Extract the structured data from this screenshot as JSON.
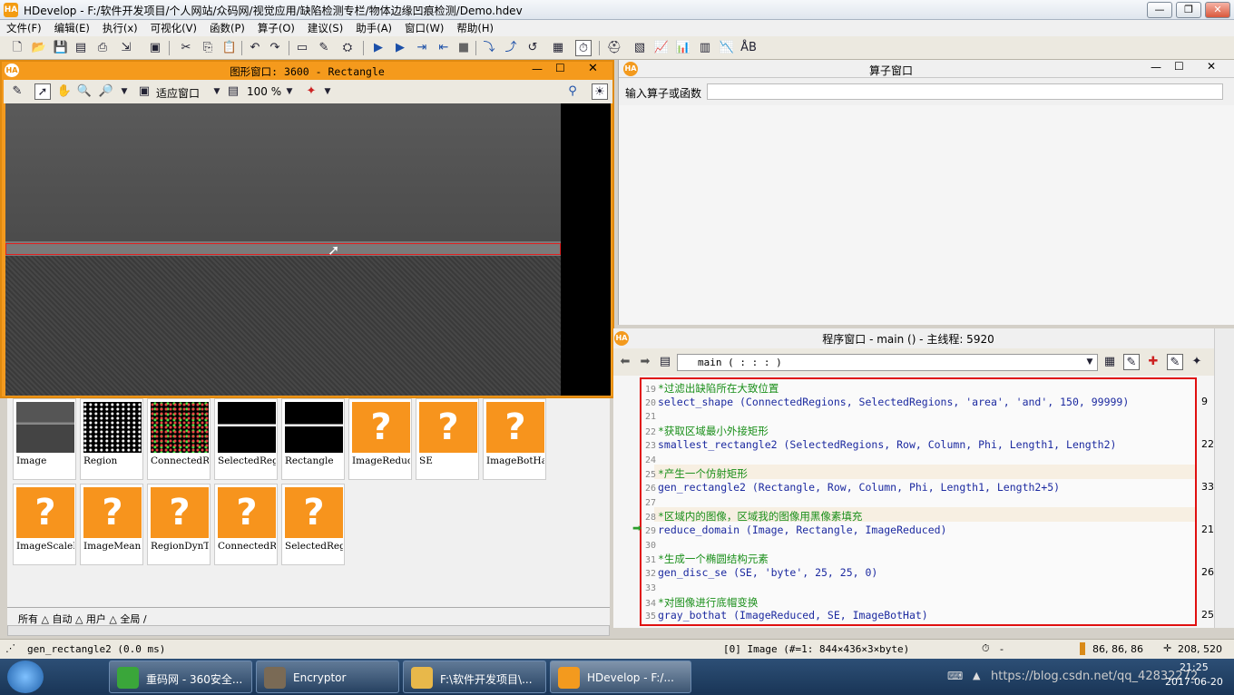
{
  "app": {
    "title": "HDevelop - F:/软件开发项目/个人网站/众码网/视觉应用/缺陷检测专栏/物体边缘凹痕检测/Demo.hdev",
    "logo": "HA"
  },
  "menu": [
    "文件(F)",
    "编辑(E)",
    "执行(x)",
    "可视化(V)",
    "函数(P)",
    "算子(O)",
    "建议(S)",
    "助手(A)",
    "窗口(W)",
    "帮助(H)"
  ],
  "graphics": {
    "title": "图形窗口: 3600 - Rectangle",
    "fit": "适应窗口",
    "zoom": "100 %"
  },
  "operator": {
    "title": "算子窗口",
    "input_label": "输入算子或函数"
  },
  "program": {
    "title": "程序窗口 - main () - 主线程: 5920",
    "proc": "main ( : : : )",
    "lines": [
      {
        "n": "19",
        "t": "*过滤出缺陷所在大致位置",
        "c": "cmt"
      },
      {
        "n": "20",
        "t": "select_shape (ConnectedRegions, SelectedRegions, 'area', 'and', 150, 99999)",
        "c": "cod"
      },
      {
        "n": "21",
        "t": "",
        "c": "cod"
      },
      {
        "n": "22",
        "t": "*获取区域最小外接矩形",
        "c": "cmt"
      },
      {
        "n": "23",
        "t": "smallest_rectangle2 (SelectedRegions, Row, Column, Phi, Length1, Length2)",
        "c": "cod"
      },
      {
        "n": "24",
        "t": "",
        "c": "cod"
      },
      {
        "n": "25",
        "t": "*产生一个仿射矩形",
        "c": "cmt"
      },
      {
        "n": "26",
        "t": "gen_rectangle2 (Rectangle, Row, Column, Phi, Length1, Length2+5)",
        "c": "cod"
      },
      {
        "n": "27",
        "t": "",
        "c": "cod"
      },
      {
        "n": "28",
        "t": "*区域内的图像，区域我的图像用黑像素填充",
        "c": "cmt"
      },
      {
        "n": "29",
        "t": "reduce_domain (Image, Rectangle, ImageReduced)",
        "c": "cod"
      },
      {
        "n": "30",
        "t": "",
        "c": "cod"
      },
      {
        "n": "31",
        "t": "*生成一个椭圆结构元素",
        "c": "cmt"
      },
      {
        "n": "32",
        "t": "gen_disc_se (SE, 'byte', 25, 25, 0)",
        "c": "cod"
      },
      {
        "n": "33",
        "t": "",
        "c": "cod"
      },
      {
        "n": "34",
        "t": "*对图像进行底帽变换",
        "c": "cmt"
      },
      {
        "n": "35",
        "t": "gray_bothat (ImageReduced, SE, ImageBotHat)",
        "c": "cod"
      }
    ],
    "right_nums": [
      "9",
      "22",
      "33",
      "21",
      "26",
      "25"
    ]
  },
  "variables": [
    {
      "label": "Image",
      "kind": "img"
    },
    {
      "label": "Region",
      "kind": "region"
    },
    {
      "label": "ConnectedRe",
      "kind": "conn"
    },
    {
      "label": "SelectedReg",
      "kind": "line"
    },
    {
      "label": "Rectangle",
      "kind": "line"
    },
    {
      "label": "ImageReduce",
      "kind": "q"
    },
    {
      "label": "SE",
      "kind": "q"
    },
    {
      "label": "ImageBotHat",
      "kind": "q"
    },
    {
      "label": "ImageScaleM",
      "kind": "q"
    },
    {
      "label": "ImageMean",
      "kind": "q"
    },
    {
      "label": "RegionDynTh",
      "kind": "q"
    },
    {
      "label": "ConnectedRe",
      "kind": "q"
    },
    {
      "label": "SelectedReg",
      "kind": "q"
    }
  ],
  "vars_tabs": "所有 △ 自动 △ 用户 △ 全局 /",
  "status": {
    "op": "gen_rectangle2 (0.0 ms)",
    "image_info": "[0] Image (#=1: 844×436×3×byte)",
    "dash": "-",
    "gray": "86, 86, 86",
    "coords": "208, 520"
  },
  "taskbar": {
    "items": [
      {
        "label": "重码网 - 360安全...",
        "color": "#3aa63a"
      },
      {
        "label": "Encryptor",
        "color": "#7a6a55"
      },
      {
        "label": "F:\\软件开发项目\\...",
        "color": "#e8b84a"
      },
      {
        "label": "HDevelop - F:/...",
        "color": "#f39a1e"
      }
    ],
    "time": "21:25",
    "date": "2017-06-20",
    "watermark": "https://blog.csdn.net/qq_42832272"
  }
}
